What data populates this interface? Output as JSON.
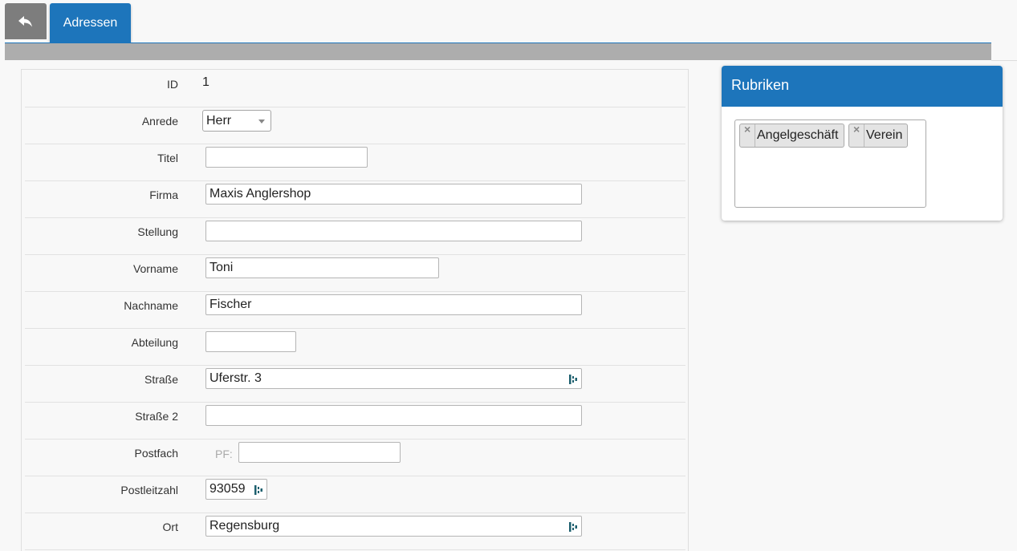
{
  "nav": {
    "back_icon": "reply-arrow-icon",
    "active_tab": "Adressen"
  },
  "form": {
    "id": {
      "label": "ID",
      "value": "1"
    },
    "anrede": {
      "label": "Anrede",
      "value": "Herr"
    },
    "titel": {
      "label": "Titel",
      "value": ""
    },
    "firma": {
      "label": "Firma",
      "value": "Maxis Anglershop"
    },
    "stellung": {
      "label": "Stellung",
      "value": ""
    },
    "vorname": {
      "label": "Vorname",
      "value": "Toni"
    },
    "nachname": {
      "label": "Nachname",
      "value": "Fischer"
    },
    "abteilung": {
      "label": "Abteilung",
      "value": ""
    },
    "strasse": {
      "label": "Straße",
      "value": "Uferstr. 3"
    },
    "strasse2": {
      "label": "Straße 2",
      "value": ""
    },
    "postfach": {
      "label": "Postfach",
      "prefix": "PF:",
      "value": ""
    },
    "plz": {
      "label": "Postleitzahl",
      "value": "93059"
    },
    "ort": {
      "label": "Ort",
      "value": "Regensburg"
    }
  },
  "rubriken": {
    "title": "Rubriken",
    "tags": [
      {
        "label": "Angelgeschäft",
        "remove": "×"
      },
      {
        "label": "Verein",
        "remove": "×"
      }
    ]
  },
  "colors": {
    "accent": "#1d75bb",
    "bar": "#adadad",
    "back_button": "#7d7d7d",
    "field_icon": "#1d5f6e"
  }
}
